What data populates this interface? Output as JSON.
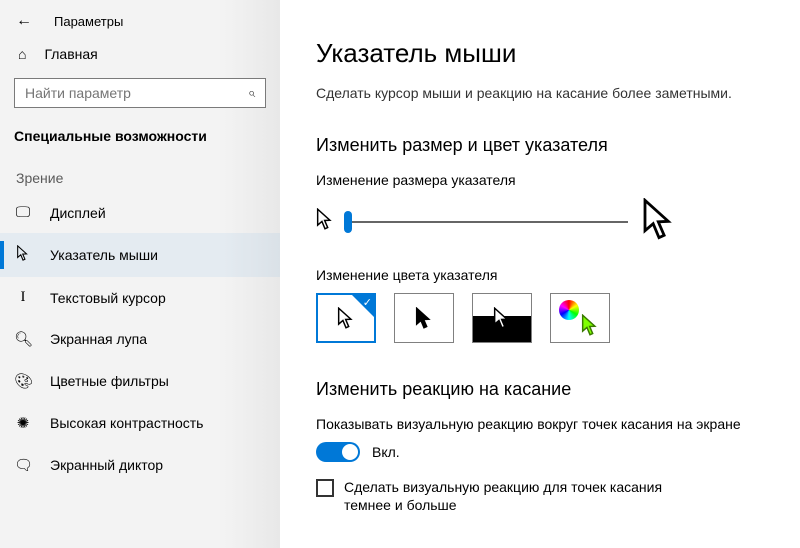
{
  "header": {
    "title": "Параметры"
  },
  "home": {
    "label": "Главная"
  },
  "search": {
    "placeholder": "Найти параметр"
  },
  "section": {
    "label": "Специальные возможности"
  },
  "group": {
    "vision": "Зрение"
  },
  "nav": [
    {
      "label": "Дисплей"
    },
    {
      "label": "Указатель мыши"
    },
    {
      "label": "Текстовый курсор"
    },
    {
      "label": "Экранная лупа"
    },
    {
      "label": "Цветные фильтры"
    },
    {
      "label": "Высокая контрастность"
    },
    {
      "label": "Экранный диктор"
    }
  ],
  "page": {
    "title": "Указатель мыши",
    "subtitle": "Сделать курсор мыши и реакцию на касание более заметными.",
    "h2_size": "Изменить размер и цвет указателя",
    "size_label": "Изменение размера указателя",
    "color_label": "Изменение цвета указателя",
    "h2_touch": "Изменить реакцию на касание",
    "touch_desc": "Показывать визуальную реакцию вокруг точек касания на экране",
    "toggle_state": "Вкл.",
    "chk_label": "Сделать визуальную реакцию для точек касания темнее и больше"
  }
}
